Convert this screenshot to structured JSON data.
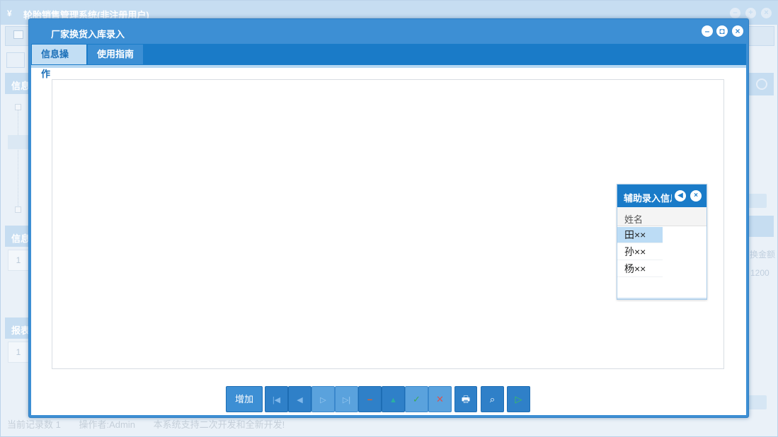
{
  "background": {
    "app_title": "轮胎销售管理系统(非注册用户)",
    "panel_info_label": "信息",
    "panel_info2_label": "信息",
    "panel_report_label": "报表",
    "row_num_1": "1",
    "row_num_2": "1",
    "right_col_header": "换金额",
    "right_col_value": "1200",
    "status": {
      "record_count": "当前记录数 1",
      "operator": "操作者:Admin",
      "notice": "本系统支持二次开发和全新开发!"
    }
  },
  "dialog": {
    "title": "厂家换货入库录入",
    "tabs": [
      {
        "label": "信息操作",
        "active": true
      },
      {
        "label": "使用指南",
        "active": false
      }
    ]
  },
  "helper": {
    "title": "辅助录入信息",
    "column": "姓名",
    "rows": [
      "田××",
      "孙××",
      "杨××"
    ],
    "selected_index": 0
  },
  "toolbar": {
    "add_label": "增加"
  },
  "colors": {
    "dialog_blue": "#3d8fd4",
    "tab_blue": "#1a7bc8",
    "active_tab": "#c2def4"
  }
}
